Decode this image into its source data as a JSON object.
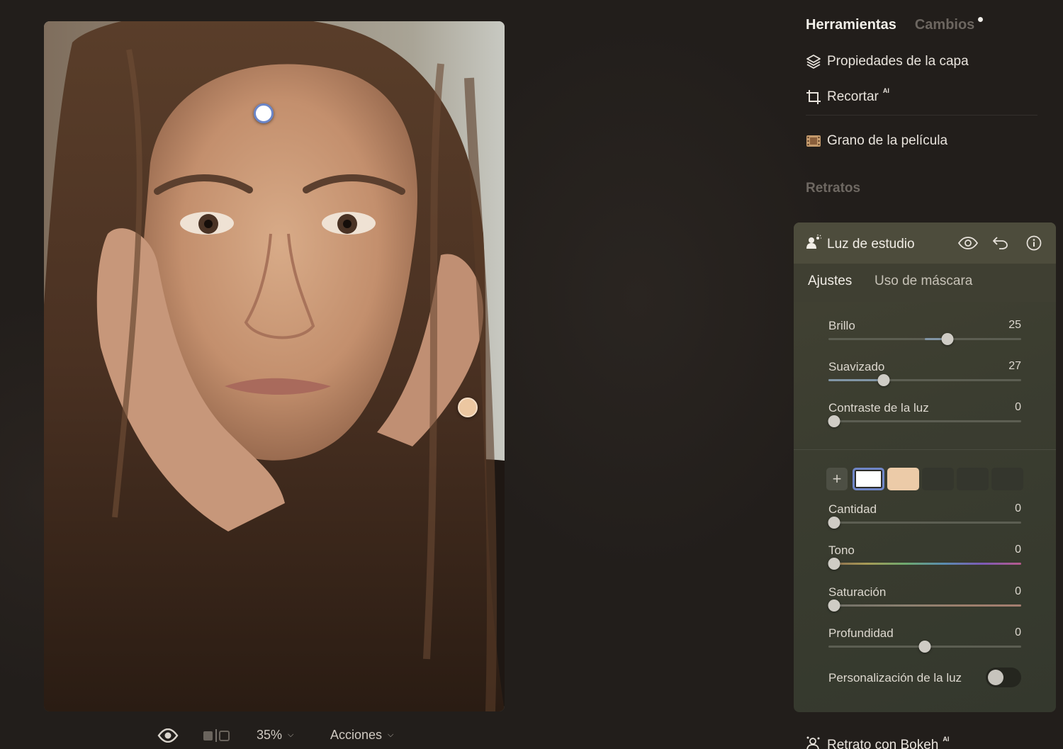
{
  "canvas": {
    "photo_alt": "portrait-photo"
  },
  "bottom_bar": {
    "zoom": "35%",
    "actions_label": "Acciones"
  },
  "panel": {
    "tabs": [
      {
        "label": "Herramientas",
        "active": true
      },
      {
        "label": "Cambios",
        "active": false,
        "has_indicator": true
      }
    ],
    "tools": [
      {
        "label": "Propiedades de la capa",
        "icon": "layers-icon"
      },
      {
        "label": "Recortar",
        "icon": "crop-icon",
        "badge": "AI"
      },
      {
        "label": "Grano de la película",
        "icon": "film-icon"
      }
    ],
    "section_portraits": "Retratos",
    "studio_light": {
      "title": "Luz de estudio",
      "icon": "person-light-icon",
      "subtabs": [
        "Ajustes",
        "Uso de máscara"
      ],
      "active_subtab": "Ajustes",
      "sliders_top": [
        {
          "label": "Brillo",
          "value": "25"
        },
        {
          "label": "Suavizado",
          "value": "27"
        },
        {
          "label": "Contraste de la luz",
          "value": "0"
        }
      ],
      "light_swatches": [
        {
          "color": "#ffffff",
          "selected": true
        },
        {
          "color": "#eccba8",
          "selected": false
        }
      ],
      "sliders_bottom": [
        {
          "label": "Cantidad",
          "value": "0"
        },
        {
          "label": "Tono",
          "value": "0"
        },
        {
          "label": "Saturación",
          "value": "0"
        },
        {
          "label": "Profundidad",
          "value": "0"
        }
      ],
      "toggle": {
        "label": "Personalización de la luz",
        "on": false
      }
    },
    "next_tool": {
      "label": "Retrato con Bokeh",
      "badge": "AI",
      "icon": "bokeh-portrait-icon"
    }
  },
  "colors": {
    "background": "#221e1b",
    "card": "#3b3d30",
    "accent_selection": "#6f86c8"
  }
}
